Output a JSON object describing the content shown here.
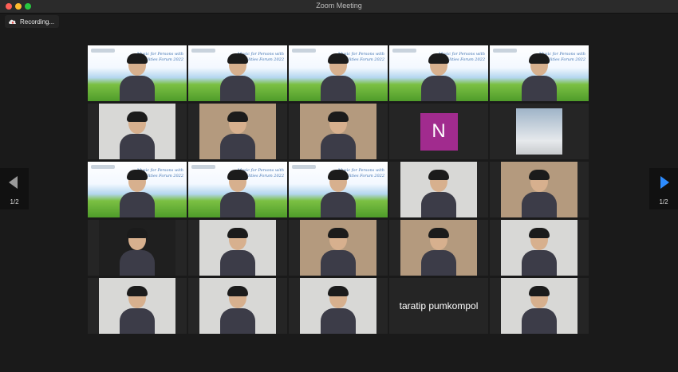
{
  "window": {
    "title": "Zoom Meeting"
  },
  "recording": {
    "label": "Recording...",
    "icon": "cloud-recording-icon"
  },
  "banner": {
    "text": "Music for Persons with Disabilities Forum 2022"
  },
  "nav": {
    "page_indicator": "1/2"
  },
  "tiles": [
    {
      "type": "banner"
    },
    {
      "type": "banner"
    },
    {
      "type": "banner",
      "active": true
    },
    {
      "type": "banner"
    },
    {
      "type": "banner"
    },
    {
      "type": "room-light"
    },
    {
      "type": "room-warm"
    },
    {
      "type": "room-warm"
    },
    {
      "type": "avatar",
      "initial": "N"
    },
    {
      "type": "photo"
    },
    {
      "type": "banner"
    },
    {
      "type": "banner"
    },
    {
      "type": "banner"
    },
    {
      "type": "room-light"
    },
    {
      "type": "room-warm"
    },
    {
      "type": "dark"
    },
    {
      "type": "room-light"
    },
    {
      "type": "room-warm"
    },
    {
      "type": "room-warm"
    },
    {
      "type": "room-light"
    },
    {
      "type": "room-light"
    },
    {
      "type": "room-light"
    },
    {
      "type": "room-light"
    },
    {
      "type": "name",
      "name": "taratip pumkompol"
    },
    {
      "type": "room-light"
    }
  ]
}
